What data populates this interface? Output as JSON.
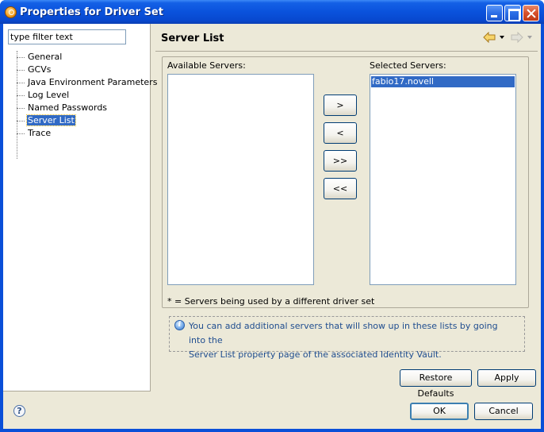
{
  "window": {
    "title": "Properties for Driver Set"
  },
  "sidebar": {
    "filter_value": "type filter text",
    "items": [
      {
        "label": "General",
        "selected": false
      },
      {
        "label": "GCVs",
        "selected": false
      },
      {
        "label": "Java Environment Parameters",
        "selected": false
      },
      {
        "label": "Log Level",
        "selected": false
      },
      {
        "label": "Named Passwords",
        "selected": false
      },
      {
        "label": "Server List",
        "selected": true
      },
      {
        "label": "Trace",
        "selected": false
      }
    ]
  },
  "page": {
    "title": "Server List",
    "available_label": "Available Servers:",
    "selected_label": "Selected Servers:",
    "available_servers": [],
    "selected_servers": [
      "fabio17.novell"
    ],
    "move_buttons": {
      "add": ">",
      "remove": "<",
      "add_all": ">>",
      "remove_all": "<<"
    },
    "note": "* = Servers being used by a different driver set",
    "info_line1": "You can add additional servers that will show up in these lists by going into the",
    "info_line2": "Server List property page of the associated Identity Vault.",
    "restore_defaults": "Restore Defaults",
    "apply": "Apply"
  },
  "footer": {
    "ok": "OK",
    "cancel": "Cancel"
  },
  "colors": {
    "selection": "#316ac5",
    "dialog_bg": "#ece9d8",
    "titlebar": "#0a52dc",
    "info_text": "#1f4d8f"
  },
  "icons": {
    "title": "properties-app-icon",
    "back": "back-arrow-icon",
    "forward": "forward-arrow-icon",
    "info": "info-icon",
    "help": "help-icon"
  }
}
